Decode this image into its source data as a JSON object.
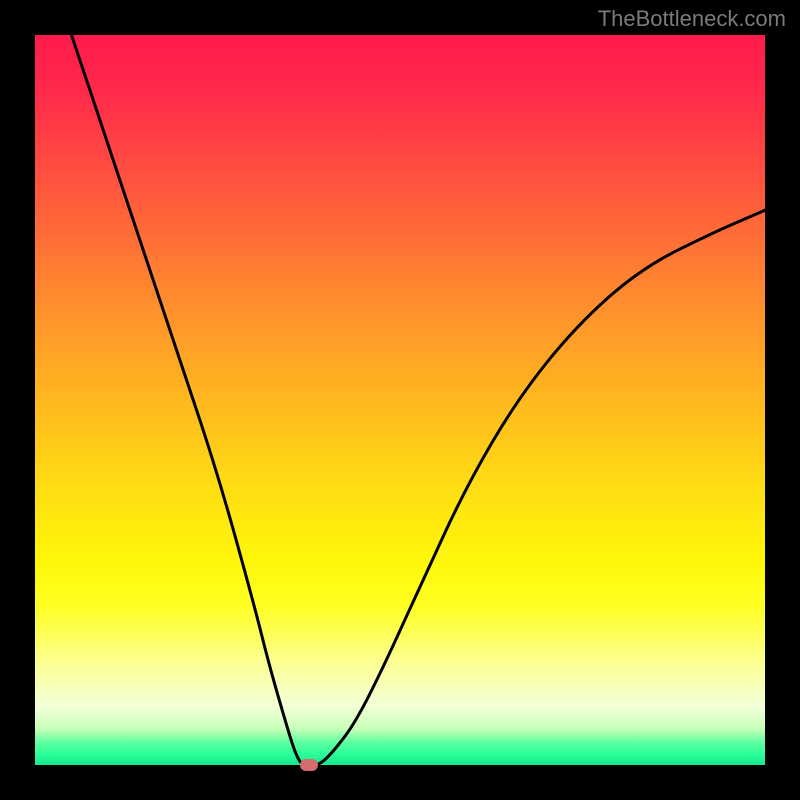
{
  "watermark": "TheBottleneck.com",
  "chart_data": {
    "type": "line",
    "title": "",
    "xlabel": "",
    "ylabel": "",
    "xlim": [
      0,
      1
    ],
    "ylim": [
      0,
      1
    ],
    "background_gradient": {
      "top_color": "#ff1a4d",
      "mid_color": "#ffe012",
      "bottom_color": "#14e88f"
    },
    "series": [
      {
        "name": "curve",
        "x": [
          0.05,
          0.1,
          0.15,
          0.2,
          0.25,
          0.3,
          0.32,
          0.34,
          0.355,
          0.365,
          0.375,
          0.39,
          0.41,
          0.44,
          0.48,
          0.53,
          0.59,
          0.66,
          0.74,
          0.83,
          0.93,
          1.0
        ],
        "y": [
          1.0,
          0.85,
          0.7,
          0.55,
          0.4,
          0.22,
          0.14,
          0.07,
          0.02,
          0.0,
          0.0,
          0.0,
          0.02,
          0.06,
          0.14,
          0.25,
          0.38,
          0.5,
          0.6,
          0.68,
          0.73,
          0.76
        ]
      }
    ],
    "marker": {
      "x": 0.375,
      "y": 0.0,
      "color": "#d66b6b"
    }
  }
}
